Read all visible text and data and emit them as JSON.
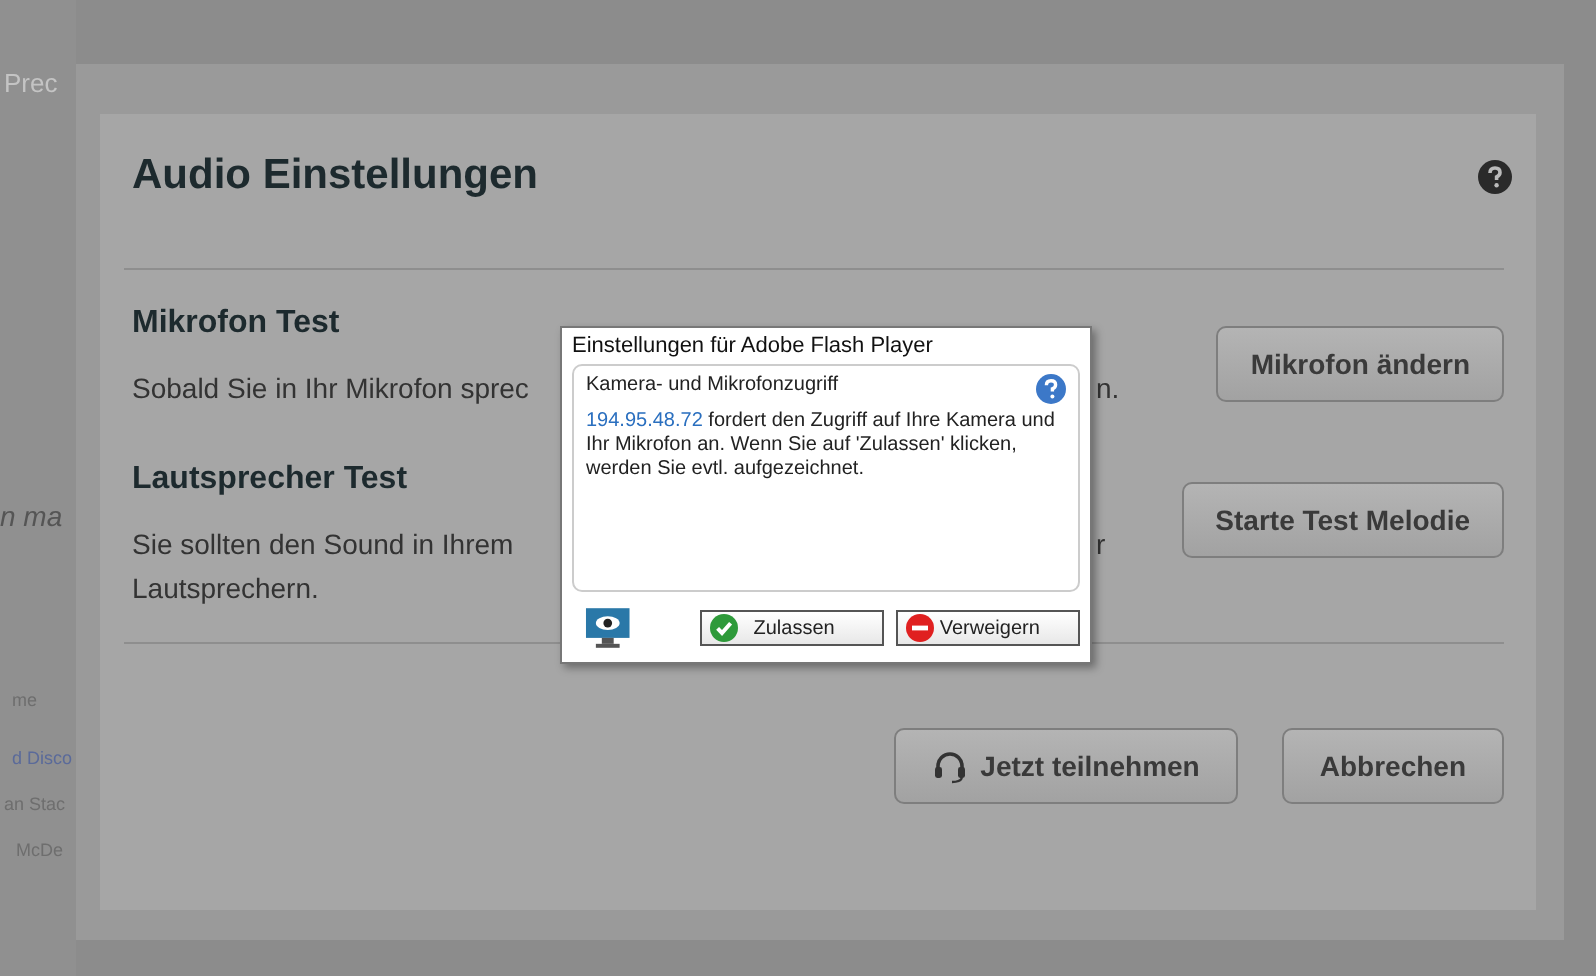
{
  "background_texts": [
    "Prec",
    "n ma",
    "me",
    "d Disco",
    "an Stac",
    "McDe"
  ],
  "dialog": {
    "title": "Audio Einstellungen",
    "sections": [
      {
        "heading": "Mikrofon Test",
        "lines": [
          "Sobald Sie in Ihr Mikrofon sprec"
        ],
        "fragment": "n.",
        "button": "Mikrofon ändern"
      },
      {
        "heading": "Lautsprecher Test",
        "lines": [
          "Sie sollten den Sound in Ihrem",
          "Lautsprechern."
        ],
        "fragment": "r",
        "button": "Starte Test Melodie"
      }
    ],
    "actions": [
      {
        "label": "Jetzt teilnehmen",
        "kind": "headset"
      },
      {
        "label": "Abbrechen",
        "kind": "plain"
      }
    ]
  },
  "flash_prompt": {
    "title": "Einstellungen für Adobe Flash Player",
    "heading": "Kamera- und Mikrofonzugriff",
    "host": "194.95.48.72",
    "message": " fordert den Zugriff auf Ihre Kamera und Ihr Mikrofon an. Wenn Sie auf 'Zulassen' klicken, werden Sie evtl. aufgezeichnet.",
    "buttons": [
      {
        "label": "Zulassen",
        "kind": "allow"
      },
      {
        "label": "Verweigern",
        "kind": "deny"
      }
    ]
  }
}
